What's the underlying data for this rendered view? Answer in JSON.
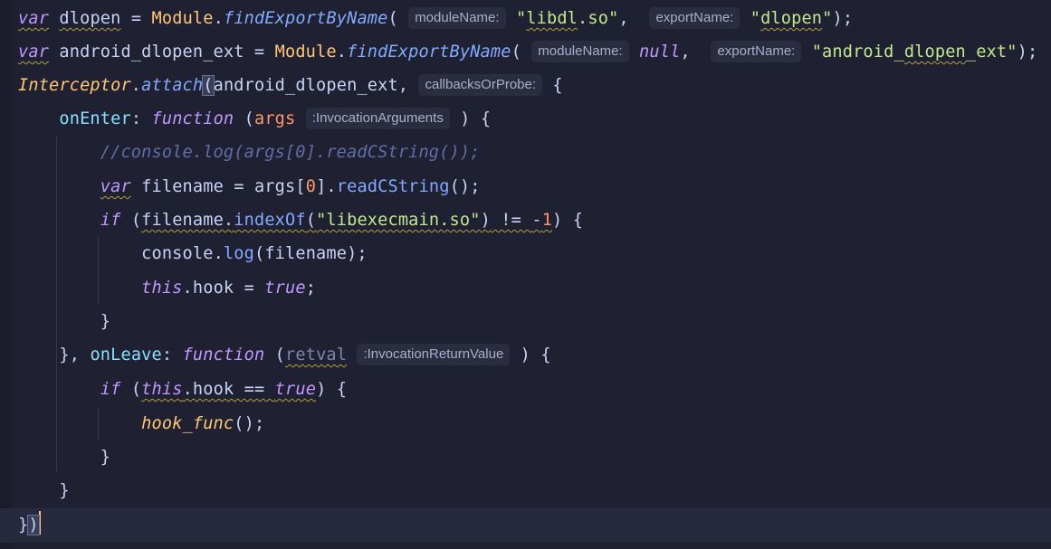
{
  "editor": {
    "lines": [
      {
        "tokens": [
          {
            "t": "var",
            "c": "kw wavy"
          },
          {
            "t": " ",
            "c": "punc"
          },
          {
            "t": "dlopen",
            "c": "ident wavy"
          },
          {
            "t": " = ",
            "c": "op"
          },
          {
            "t": "Module",
            "c": "cls"
          },
          {
            "t": ".",
            "c": "punc"
          },
          {
            "t": "findExportByName",
            "c": "method"
          },
          {
            "t": "( ",
            "c": "punc"
          },
          {
            "t": "moduleName:",
            "c": "hint"
          },
          {
            "t": " ",
            "c": "punc"
          },
          {
            "t": "\"",
            "c": "str"
          },
          {
            "t": "libdl",
            "c": "str wavy"
          },
          {
            "t": ".so\"",
            "c": "str"
          },
          {
            "t": ",  ",
            "c": "punc"
          },
          {
            "t": "exportName:",
            "c": "hint"
          },
          {
            "t": " ",
            "c": "punc"
          },
          {
            "t": "\"",
            "c": "str"
          },
          {
            "t": "dlopen",
            "c": "str wavy"
          },
          {
            "t": "\"",
            "c": "str"
          },
          {
            "t": ");",
            "c": "punc"
          }
        ]
      },
      {
        "tokens": [
          {
            "t": "var",
            "c": "kw wavy"
          },
          {
            "t": " android_dlopen_ext = ",
            "c": "ident"
          },
          {
            "t": "Module",
            "c": "cls"
          },
          {
            "t": ".",
            "c": "punc"
          },
          {
            "t": "findExportByName",
            "c": "method"
          },
          {
            "t": "( ",
            "c": "punc"
          },
          {
            "t": "moduleName:",
            "c": "hint"
          },
          {
            "t": " ",
            "c": "punc"
          },
          {
            "t": "null",
            "c": "bool"
          },
          {
            "t": ",  ",
            "c": "punc"
          },
          {
            "t": "exportName:",
            "c": "hint"
          },
          {
            "t": " ",
            "c": "punc"
          },
          {
            "t": "\"android_",
            "c": "str"
          },
          {
            "t": "dlopen",
            "c": "str wavy"
          },
          {
            "t": "_ext\"",
            "c": "str"
          },
          {
            "t": ");",
            "c": "punc"
          }
        ]
      },
      {
        "tokens": [
          {
            "t": "Interceptor",
            "c": "call-italic"
          },
          {
            "t": ".",
            "c": "punc"
          },
          {
            "t": "attach",
            "c": "method"
          },
          {
            "t": "(",
            "c": "punc brace-match"
          },
          {
            "t": "android_dlopen_ext, ",
            "c": "ident"
          },
          {
            "t": "callbacksOrProbe:",
            "c": "hint"
          },
          {
            "t": " ",
            "c": "punc"
          },
          {
            "t": "{",
            "c": "brace"
          }
        ]
      },
      {
        "tokens": [
          {
            "t": "    ",
            "c": "punc"
          },
          {
            "t": "onEnter",
            "c": "prop"
          },
          {
            "t": ": ",
            "c": "punc"
          },
          {
            "t": "function",
            "c": "kw"
          },
          {
            "t": " (",
            "c": "punc"
          },
          {
            "t": "args",
            "c": "param"
          },
          {
            "t": " ",
            "c": "punc"
          },
          {
            "t": ":InvocationArguments",
            "c": "hint"
          },
          {
            "t": " ) {",
            "c": "punc"
          }
        ]
      },
      {
        "tokens": [
          {
            "t": "        ",
            "c": "punc"
          },
          {
            "t": "//console.log(args[0].readCString());",
            "c": "comment"
          }
        ]
      },
      {
        "tokens": [
          {
            "t": "        ",
            "c": "punc"
          },
          {
            "t": "var",
            "c": "kw wavy"
          },
          {
            "t": " filename = ",
            "c": "ident"
          },
          {
            "t": "args",
            "c": "ident"
          },
          {
            "t": "[",
            "c": "punc"
          },
          {
            "t": "0",
            "c": "num"
          },
          {
            "t": "].",
            "c": "punc"
          },
          {
            "t": "readCString",
            "c": "fn"
          },
          {
            "t": "();",
            "c": "punc"
          }
        ]
      },
      {
        "tokens": [
          {
            "t": "        ",
            "c": "punc"
          },
          {
            "t": "if",
            "c": "kw"
          },
          {
            "t": " (",
            "c": "punc"
          },
          {
            "t": "filename.",
            "c": "ident wavy"
          },
          {
            "t": "indexOf",
            "c": "fn wavy"
          },
          {
            "t": "(",
            "c": "punc wavy"
          },
          {
            "t": "\"libexecmain.so\"",
            "c": "str wavy"
          },
          {
            "t": ")",
            "c": "punc wavy"
          },
          {
            "t": " != ",
            "c": "op wavy"
          },
          {
            "t": "-",
            "c": "op wavy"
          },
          {
            "t": "1",
            "c": "num wavy"
          },
          {
            "t": ") {",
            "c": "punc"
          }
        ]
      },
      {
        "tokens": [
          {
            "t": "            ",
            "c": "punc"
          },
          {
            "t": "console",
            "c": "ident"
          },
          {
            "t": ".",
            "c": "punc"
          },
          {
            "t": "log",
            "c": "fn"
          },
          {
            "t": "(filename);",
            "c": "punc"
          }
        ]
      },
      {
        "tokens": [
          {
            "t": "            ",
            "c": "punc"
          },
          {
            "t": "this",
            "c": "this"
          },
          {
            "t": ".hook = ",
            "c": "ident"
          },
          {
            "t": "true",
            "c": "bool"
          },
          {
            "t": ";",
            "c": "punc"
          }
        ]
      },
      {
        "tokens": [
          {
            "t": "        ",
            "c": "punc"
          },
          {
            "t": "}",
            "c": "brace"
          }
        ]
      },
      {
        "tokens": [
          {
            "t": "    ",
            "c": "punc"
          },
          {
            "t": "}, ",
            "c": "punc"
          },
          {
            "t": "onLeave",
            "c": "prop"
          },
          {
            "t": ": ",
            "c": "punc"
          },
          {
            "t": "function",
            "c": "kw"
          },
          {
            "t": " (",
            "c": "punc"
          },
          {
            "t": "retval",
            "c": "param-dim wavy"
          },
          {
            "t": " ",
            "c": "punc"
          },
          {
            "t": ":InvocationReturnValue",
            "c": "hint"
          },
          {
            "t": " ) {",
            "c": "punc"
          }
        ]
      },
      {
        "tokens": [
          {
            "t": "        ",
            "c": "punc"
          },
          {
            "t": "if",
            "c": "kw"
          },
          {
            "t": " (",
            "c": "punc"
          },
          {
            "t": "this",
            "c": "this wavy"
          },
          {
            "t": ".hook == ",
            "c": "ident wavy"
          },
          {
            "t": "true",
            "c": "bool wavy"
          },
          {
            "t": ") {",
            "c": "punc"
          }
        ]
      },
      {
        "tokens": [
          {
            "t": "            ",
            "c": "punc"
          },
          {
            "t": "hook_func",
            "c": "call-italic"
          },
          {
            "t": "();",
            "c": "punc"
          }
        ]
      },
      {
        "tokens": [
          {
            "t": "        ",
            "c": "punc"
          },
          {
            "t": "}",
            "c": "brace"
          }
        ]
      },
      {
        "tokens": [
          {
            "t": "    ",
            "c": "punc"
          },
          {
            "t": "}",
            "c": "brace"
          }
        ]
      },
      {
        "current": true,
        "tokens": [
          {
            "t": "}",
            "c": "brace"
          },
          {
            "t": ")",
            "c": "punc brace-match"
          }
        ]
      }
    ]
  }
}
